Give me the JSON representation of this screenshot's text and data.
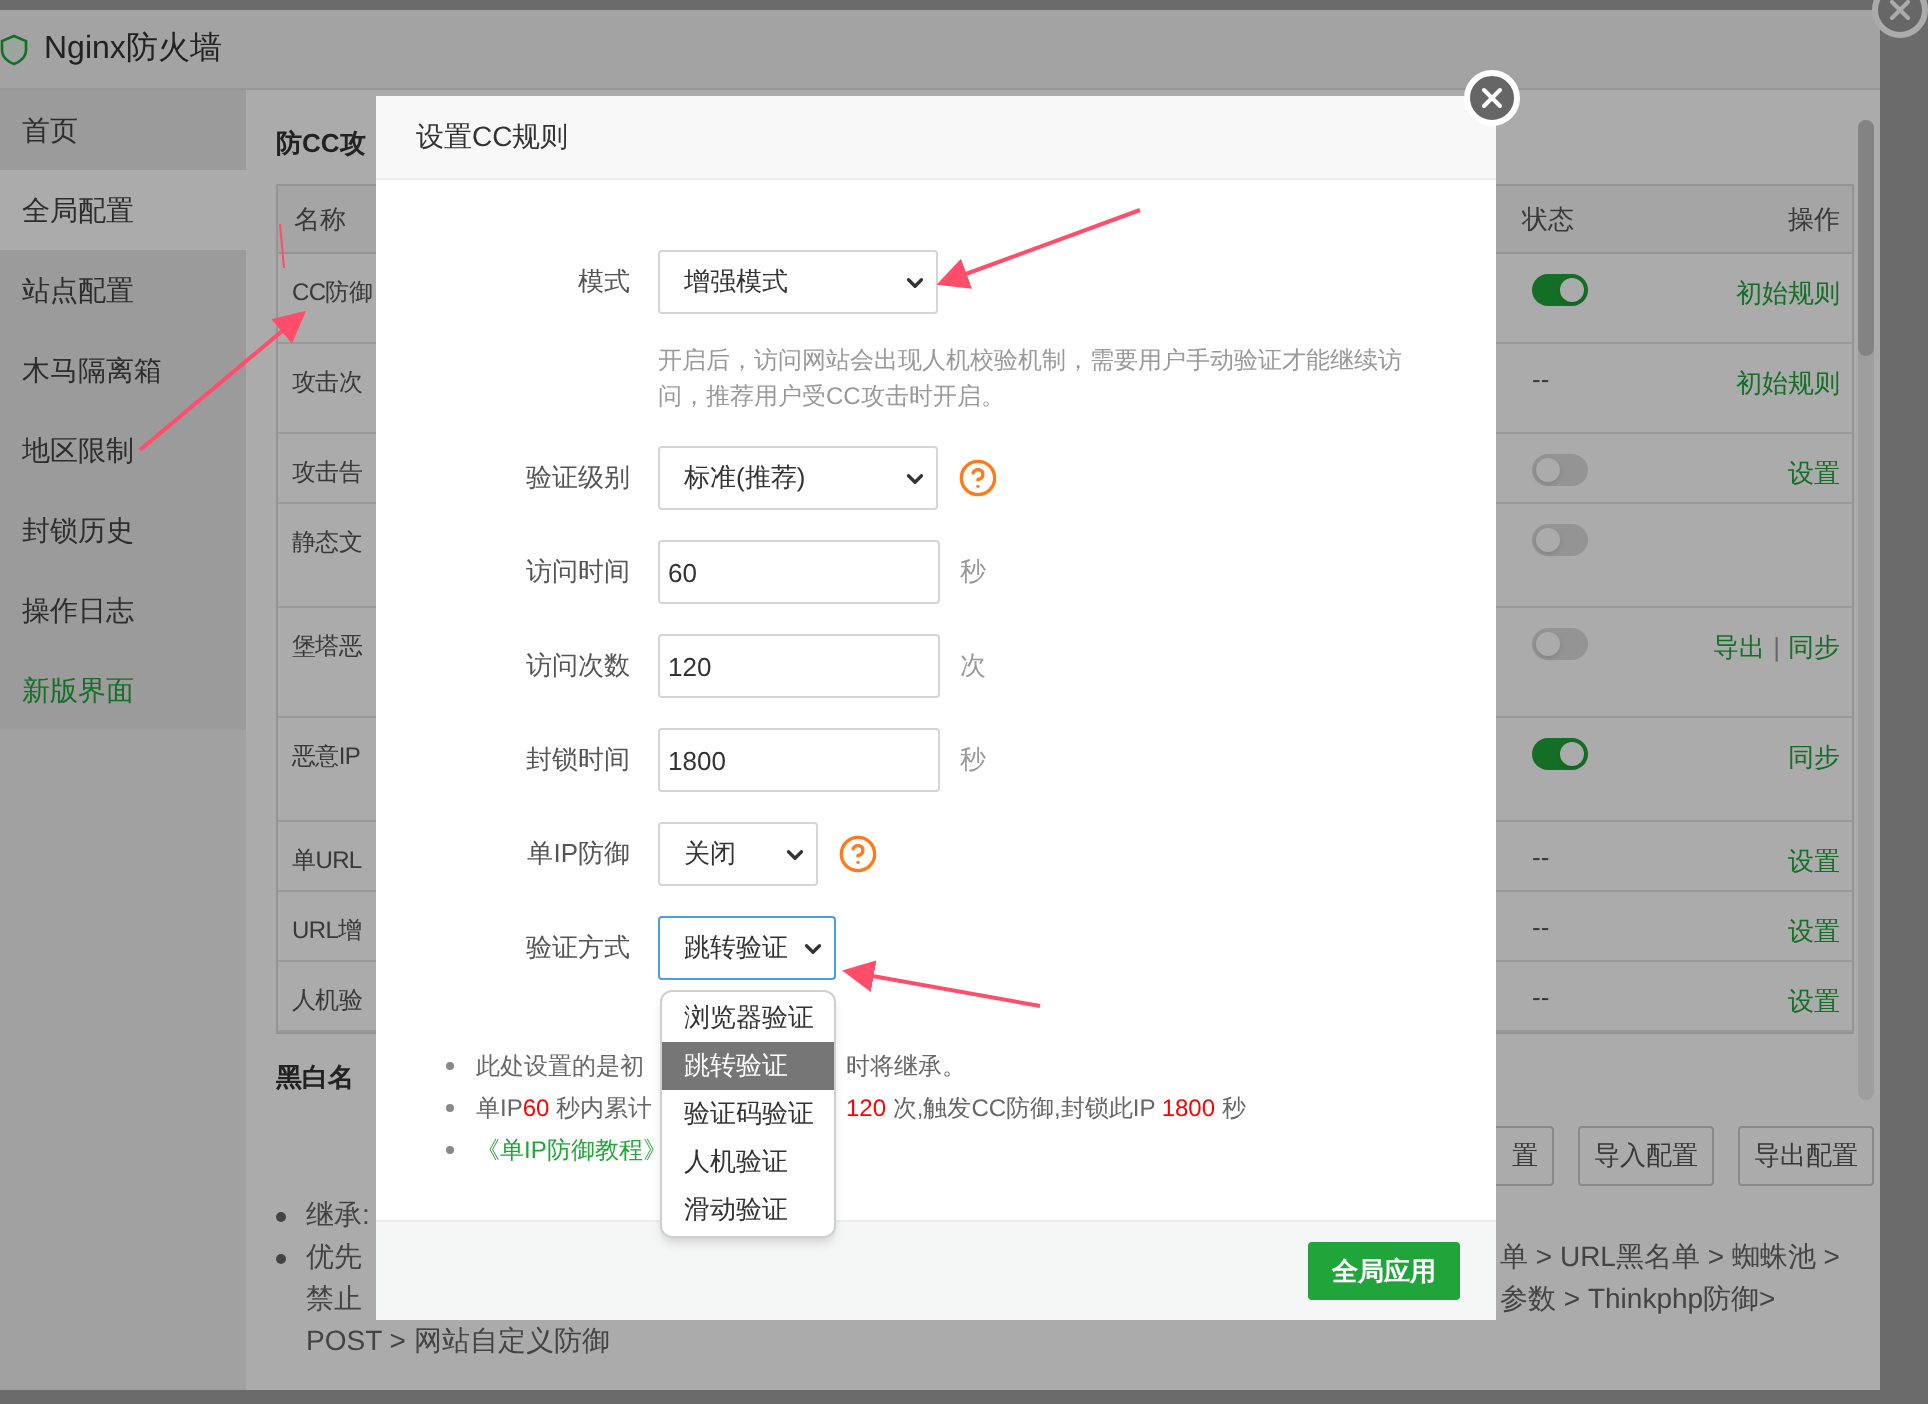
{
  "window": {
    "title": "Nginx防火墙"
  },
  "sidebar": {
    "items": [
      {
        "label": "首页",
        "selected": false,
        "kind": "page"
      },
      {
        "label": "全局配置",
        "selected": true,
        "kind": "page"
      },
      {
        "label": "站点配置",
        "selected": false,
        "kind": "page"
      },
      {
        "label": "木马隔离箱",
        "selected": false,
        "kind": "page"
      },
      {
        "label": "地区限制",
        "selected": false,
        "kind": "page"
      },
      {
        "label": "封锁历史",
        "selected": false,
        "kind": "page"
      },
      {
        "label": "操作日志",
        "selected": false,
        "kind": "page"
      },
      {
        "label": "新版界面",
        "selected": false,
        "kind": "link"
      }
    ]
  },
  "content": {
    "heading": "防CC攻",
    "table": {
      "columns": [
        "名称",
        "状态",
        "操作"
      ],
      "action_separator": "|",
      "rows": [
        {
          "name": "CC防御",
          "status": {
            "kind": "toggle",
            "on": true
          },
          "actions": [
            "初始规则"
          ]
        },
        {
          "name": "攻击次",
          "status": {
            "kind": "text",
            "text": "--"
          },
          "actions": [
            "初始规则"
          ]
        },
        {
          "name": "攻击告",
          "status": {
            "kind": "toggle",
            "on": false
          },
          "actions": [
            "设置"
          ]
        },
        {
          "name": "静态文",
          "status": {
            "kind": "toggle",
            "on": false
          },
          "actions": []
        },
        {
          "name": "堡塔恶",
          "status": {
            "kind": "toggle",
            "on": false
          },
          "actions": [
            "导出",
            "同步"
          ]
        },
        {
          "name": "恶意IP",
          "status": {
            "kind": "toggle",
            "on": true
          },
          "actions": [
            "同步"
          ]
        },
        {
          "name": "单URL",
          "status": {
            "kind": "text",
            "text": "--"
          },
          "actions": [
            "设置"
          ]
        },
        {
          "name": "URL增",
          "status": {
            "kind": "text",
            "text": "--"
          },
          "actions": [
            "设置"
          ]
        },
        {
          "name": "人机验",
          "status": {
            "kind": "text",
            "text": "--"
          },
          "actions": [
            "设置"
          ]
        }
      ]
    },
    "section_heading": "黑白名",
    "buttons": [
      "置",
      "导入配置",
      "导出配置"
    ],
    "notes": [
      {
        "lines": [
          {
            "left": "继承:"
          }
        ]
      },
      {
        "lines": [
          {
            "left": "优先",
            "right": "单 > URL黑名单 > 蜘蛛池 >"
          },
          {
            "left": "禁止",
            "right": "参数 > Thinkphp防御>"
          },
          {
            "left": "POST > 网站自定义防御"
          }
        ]
      }
    ]
  },
  "dialog": {
    "title": "设置CC规则",
    "fields": [
      {
        "kind": "select",
        "label": "模式",
        "value": "增强模式",
        "help": false,
        "focused": false
      },
      {
        "kind": "description",
        "text": "开启后，访问网站会出现人机校验机制，需要用户手动验证才能继续访问，推荐用户受CC攻击时开启。"
      },
      {
        "kind": "select",
        "label": "验证级别",
        "value": "标准(推荐)",
        "help": true,
        "focused": false
      },
      {
        "kind": "input",
        "label": "访问时间",
        "value": "60",
        "unit": "秒"
      },
      {
        "kind": "input",
        "label": "访问次数",
        "value": "120",
        "unit": "次"
      },
      {
        "kind": "input",
        "label": "封锁时间",
        "value": "1800",
        "unit": "秒"
      },
      {
        "kind": "select",
        "label": "单IP防御",
        "value": "关闭",
        "help": true,
        "focused": false
      },
      {
        "kind": "select",
        "label": "验证方式",
        "value": "跳转验证",
        "help": false,
        "focused": true,
        "options": [
          {
            "label": "浏览器验证",
            "selected": false
          },
          {
            "label": "跳转验证",
            "selected": true
          },
          {
            "label": "验证码验证",
            "selected": false
          },
          {
            "label": "人机验证",
            "selected": false
          },
          {
            "label": "滑动验证",
            "selected": false
          }
        ]
      }
    ],
    "notes": [
      {
        "kind": "text",
        "left": [
          {
            "text": "此处设置的是初",
            "highlight": false
          }
        ],
        "right": [
          {
            "text": "时将继承。",
            "highlight": false
          }
        ]
      },
      {
        "kind": "text",
        "left": [
          {
            "text": "单IP",
            "highlight": false
          },
          {
            "text": "60",
            "highlight": true
          },
          {
            "text": " 秒内累计",
            "highlight": false
          }
        ],
        "right": [
          {
            "text": "120",
            "highlight": true
          },
          {
            "text": " 次,触发CC防御,封锁此IP ",
            "highlight": false
          },
          {
            "text": "1800",
            "highlight": true
          },
          {
            "text": " 秒",
            "highlight": false
          }
        ]
      },
      {
        "kind": "link",
        "left": [
          {
            "text": "《单IP防御教程》",
            "highlight": false
          }
        ]
      }
    ],
    "primary_button": "全局应用"
  }
}
